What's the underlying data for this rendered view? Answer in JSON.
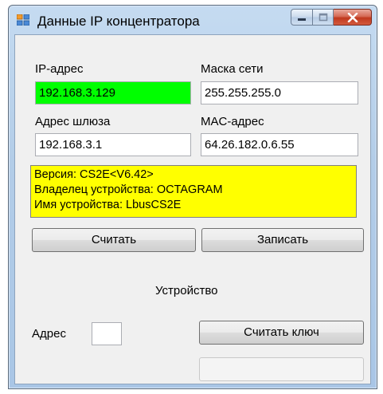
{
  "window": {
    "title": "Данные IP концентратора",
    "controls": {
      "minimize": "minimize-icon",
      "maximize": "maximize-icon",
      "close": "close-icon"
    }
  },
  "fields": {
    "ip_label": "IP-адрес",
    "ip_value": "192.168.3.129",
    "mask_label": "Маска сети",
    "mask_value": "255.255.255.0",
    "gateway_label": "Адрес шлюза",
    "gateway_value": "192.168.3.1",
    "mac_label": "MAC-адрес",
    "mac_value": "64.26.182.0.6.55"
  },
  "info": {
    "version": "Версия: CS2E<V6.42>",
    "owner": "Владелец устройства: OCTAGRAM",
    "name": "Имя устройства: LbusCS2E"
  },
  "buttons": {
    "read": "Считать",
    "write": "Записать",
    "read_key": "Считать ключ"
  },
  "device": {
    "title": "Устройство",
    "address_label": "Адрес",
    "address_value": ""
  },
  "colors": {
    "ip_background": "#00ff00",
    "info_background": "#ffff00",
    "client_background": "#f0f0f0"
  }
}
